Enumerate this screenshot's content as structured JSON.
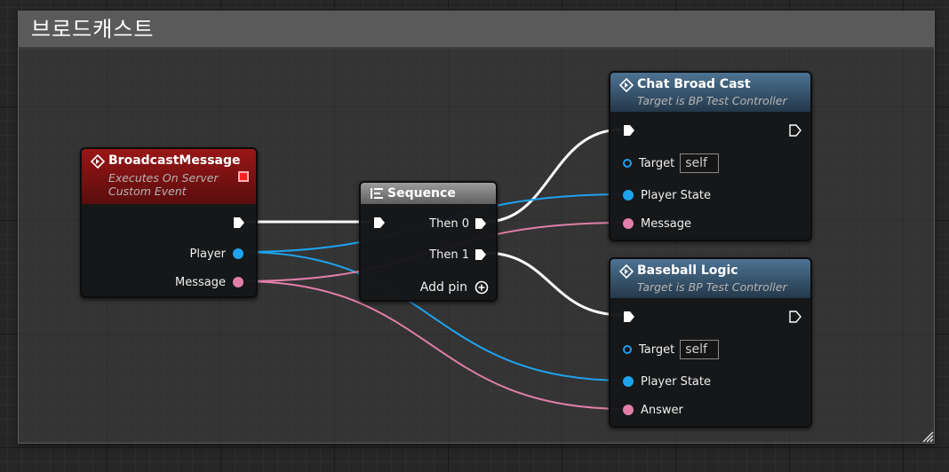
{
  "comment": {
    "title": "브로드캐스트"
  },
  "colors": {
    "event_header": "#8c1515",
    "function_header": "#3d5f7a",
    "sequence_header": "#8f8f8f",
    "exec_wire": "#ffffff",
    "object_pin": "#1ea3ee",
    "string_pin": "#e27fa9"
  },
  "icons": {
    "event": "diamond-arrow-icon",
    "function": "function-diamond-icon",
    "sequence": "sequence-icon",
    "add": "plus-circle-icon",
    "resize": "resize-grip-icon"
  },
  "event_node": {
    "title": "BroadcastMessage",
    "subtitle_1": "Executes On Server",
    "subtitle_2": "Custom Event",
    "pins": {
      "player": "Player",
      "message": "Message"
    }
  },
  "sequence_node": {
    "title": "Sequence",
    "pins": {
      "then0": "Then 0",
      "then1": "Then 1"
    },
    "add_pin": "Add pin"
  },
  "chat_node": {
    "title": "Chat Broad Cast",
    "subtitle": "Target is BP Test Controller",
    "pins": {
      "target": "Target",
      "target_value": "self",
      "player_state": "Player State",
      "message": "Message"
    }
  },
  "baseball_node": {
    "title": "Baseball Logic",
    "subtitle": "Target is BP Test Controller",
    "pins": {
      "target": "Target",
      "target_value": "self",
      "player_state": "Player State",
      "answer": "Answer"
    }
  }
}
